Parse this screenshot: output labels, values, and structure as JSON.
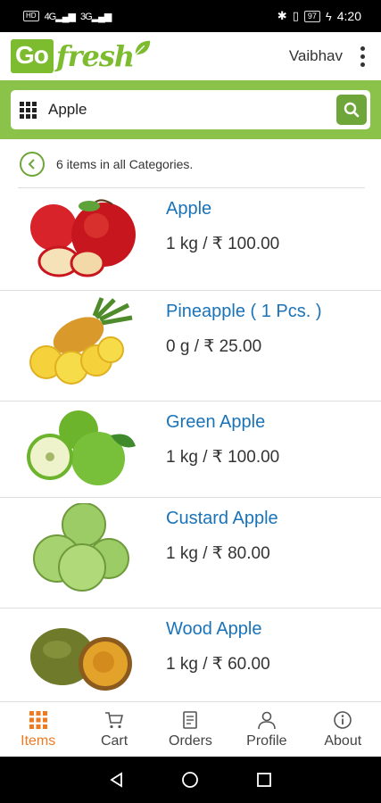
{
  "status_bar": {
    "left_badges": [
      "HD",
      "4G",
      "3G"
    ],
    "battery": "97",
    "time": "4:20"
  },
  "header": {
    "logo_part1": "Go",
    "logo_part2": "fresh",
    "user_name": "Vaibhav"
  },
  "search": {
    "value": "Apple"
  },
  "results": {
    "text": "6 items in all Categories."
  },
  "items": [
    {
      "name": "Apple",
      "price": "1 kg / ₹  100.00"
    },
    {
      "name": "Pineapple ( 1 Pcs. )",
      "price": "0 g / ₹ 25.00"
    },
    {
      "name": "Green Apple",
      "price": "1 kg / ₹  100.00"
    },
    {
      "name": "Custard Apple",
      "price": "1 kg / ₹  80.00"
    },
    {
      "name": "Wood Apple",
      "price": "1 kg / ₹  60.00"
    }
  ],
  "bottom_nav": [
    {
      "label": "Items",
      "icon": "grid-icon"
    },
    {
      "label": "Cart",
      "icon": "cart-icon"
    },
    {
      "label": "Orders",
      "icon": "orders-icon"
    },
    {
      "label": "Profile",
      "icon": "profile-icon"
    },
    {
      "label": "About",
      "icon": "info-icon"
    }
  ],
  "colors": {
    "brand_green": "#7dbb2f",
    "search_bg": "#8bc34a",
    "link_blue": "#1a73b8",
    "active_orange": "#ee7a22"
  }
}
